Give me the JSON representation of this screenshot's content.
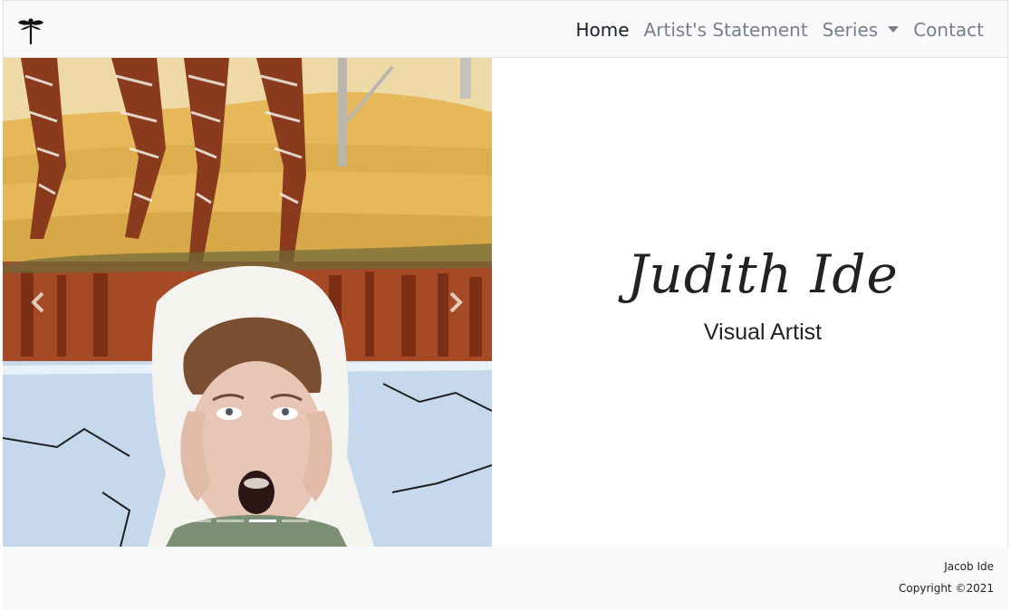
{
  "nav": {
    "logo_icon": "dragonfly-icon",
    "links": [
      {
        "label": "Home",
        "active": true
      },
      {
        "label": "Artist's Statement",
        "active": false
      },
      {
        "label": "Series",
        "active": false,
        "dropdown": true
      },
      {
        "label": "Contact",
        "active": false
      }
    ]
  },
  "carousel": {
    "prev_icon": "chevron-left-icon",
    "next_icon": "chevron-right-icon",
    "indicator_count": 4,
    "active_index": 2
  },
  "hero": {
    "name": "Judith Ide",
    "subtitle": "Visual Artist"
  },
  "footer": {
    "line1": "Jacob Ide",
    "line2": "Copyright ©2021"
  },
  "colors": {
    "navbar_bg": "#f8f9fa",
    "footer_bg": "#f8f9fa",
    "nav_active": "#1c1f23",
    "nav_inactive": "#7b7f84"
  }
}
